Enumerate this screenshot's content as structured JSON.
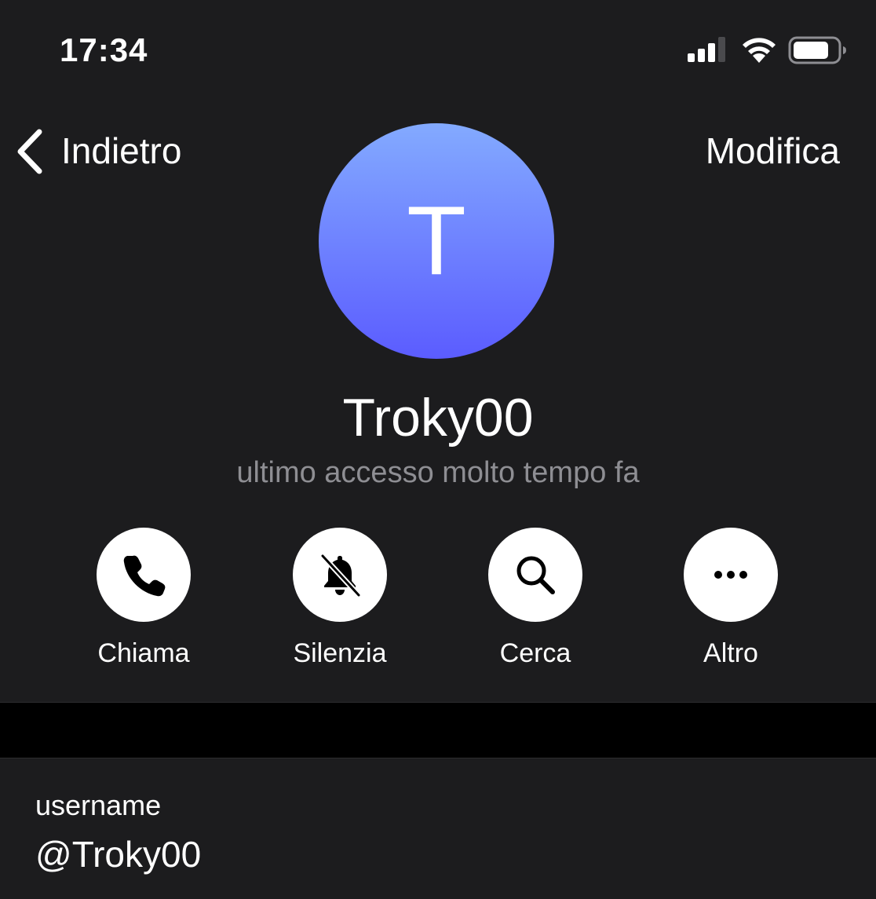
{
  "status_bar": {
    "time": "17:34",
    "icons": [
      "signal-bars-icon",
      "wifi-icon",
      "battery-icon"
    ]
  },
  "nav": {
    "back_icon": "chevron-left-icon",
    "back_label": "Indietro",
    "edit_label": "Modifica"
  },
  "profile": {
    "avatar_initial": "T",
    "avatar_gradient": [
      "#83aaff",
      "#5b5cff"
    ],
    "name": "Troky00",
    "last_seen": "ultimo accesso molto tempo fa"
  },
  "actions": [
    {
      "label": "Chiama",
      "icon": "phone-icon"
    },
    {
      "label": "Silenzia",
      "icon": "bell-slash-icon"
    },
    {
      "label": "Cerca",
      "icon": "search-icon"
    },
    {
      "label": "Altro",
      "icon": "more-dots-icon"
    }
  ],
  "info": {
    "username_label": "username",
    "username_value": "@Troky00"
  },
  "colors": {
    "panel_background": "#1c1c1e",
    "page_background": "#000000",
    "secondary_text": "#8e8e93",
    "action_circle": "#ffffff"
  }
}
